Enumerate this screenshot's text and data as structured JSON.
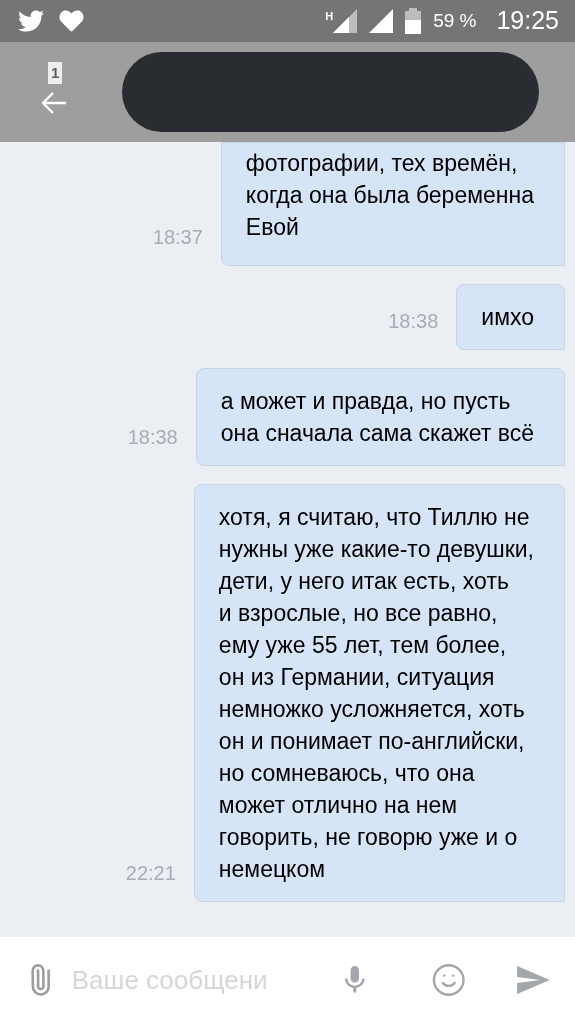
{
  "status_bar": {
    "network": "H",
    "battery": "59 %",
    "time": "19:25"
  },
  "header": {
    "badge": "1"
  },
  "messages": [
    {
      "text": "фотографии, тех времён,\nкогда она была беременна\nЕвой",
      "time": "18:37"
    },
    {
      "text": "имхо",
      "time": "18:38"
    },
    {
      "text": "а может и правда, но пусть\nона сначала сама скажет всё",
      "time": "18:38"
    },
    {
      "text": "хотя, я считаю, что Тиллю не\nнужны уже какие-то девушки,\nдети, у него итак есть, хоть\nи взрослые, но все равно,\nему уже 55 лет, тем более,\nон из Германии, ситуация\nнемножко усложняется, хоть\nон и понимает по-английски,\nно сомневаюсь, что она\nможет отлично на нем\nговорить, не говорю уже и о\nнемецком",
      "time": "22:21"
    }
  ],
  "composer": {
    "placeholder": "Ваше сообщени"
  }
}
